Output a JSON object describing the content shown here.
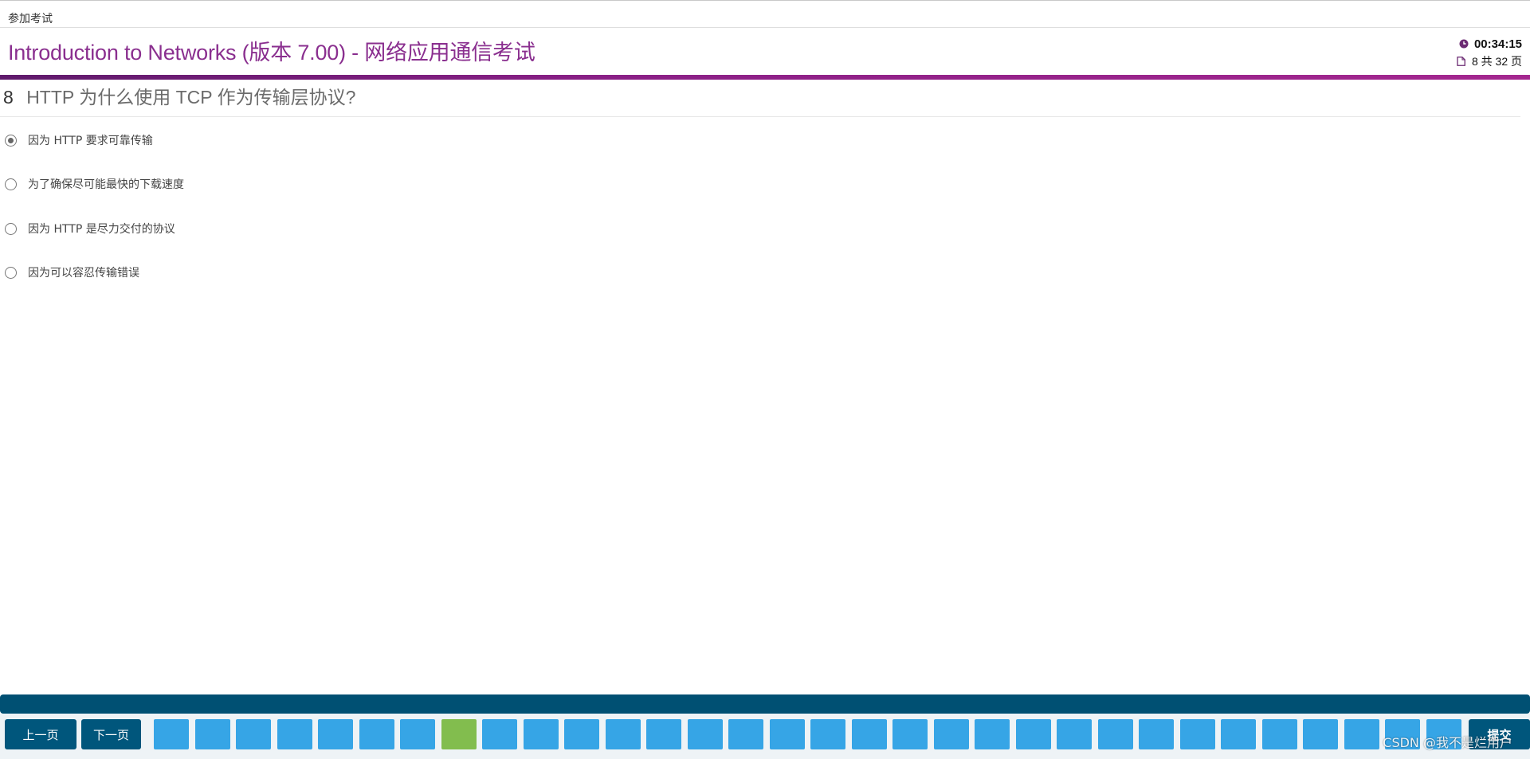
{
  "header": {
    "context": "参加考试",
    "exam_title": "Introduction to Networks (版本 7.00) - 网络应用通信考试",
    "timer": "00:34:15",
    "page_info": "8 共 32 页"
  },
  "question": {
    "number": "8",
    "text": "HTTP 为什么使用 TCP 作为传输层协议?"
  },
  "options": [
    {
      "label": "因为 HTTP 要求可靠传输",
      "selected": true
    },
    {
      "label": "为了确保尽可能最快的下载速度",
      "selected": false
    },
    {
      "label": "因为 HTTP 是尽力交付的协议",
      "selected": false
    },
    {
      "label": "因为可以容忍传输错误",
      "selected": false
    }
  ],
  "navigation": {
    "prev_label": "上一页",
    "next_label": "下一页",
    "submit_label": "提交",
    "visible_question_boxes": 32,
    "current_question": 8
  },
  "colors": {
    "title_purple": "#8a2f8f",
    "nav_dark_blue": "#00567c",
    "question_box_blue": "#36a5e6",
    "current_box_green": "#82bd4e"
  },
  "icons": {
    "timer": "clock-icon",
    "page": "document-icon"
  },
  "watermark": "CSDN @我不是烂用户"
}
